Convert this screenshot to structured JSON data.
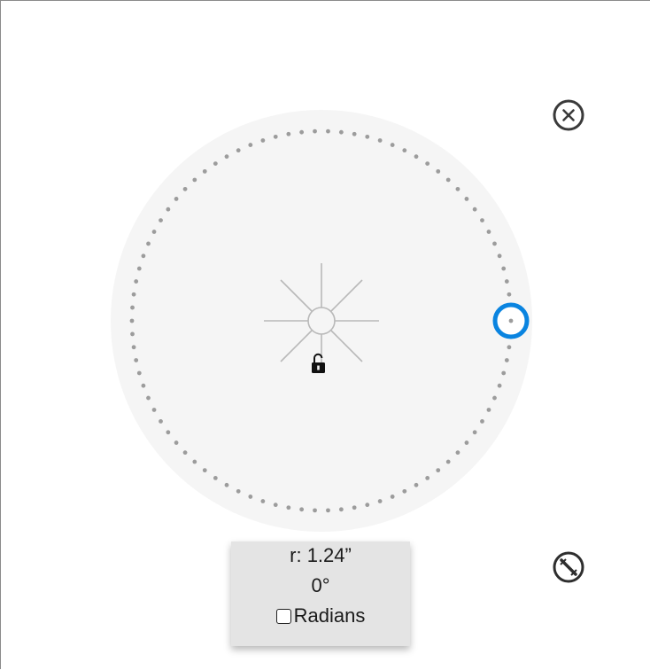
{
  "protractor": {
    "radius_label": "r: 1.24”",
    "angle_label": "0°",
    "radians_label": "Radians",
    "radians_checked": false,
    "lock_state": "unlocked",
    "accent_color": "#0a84e0",
    "dial_color": "#f5f5f5",
    "dot_color": "#9c9c9c"
  },
  "icons": {
    "close": "close-circle-icon",
    "ruler": "ruler-slash-icon",
    "lock": "unlocked-padlock-icon",
    "center": "center-crosshair-icon"
  }
}
